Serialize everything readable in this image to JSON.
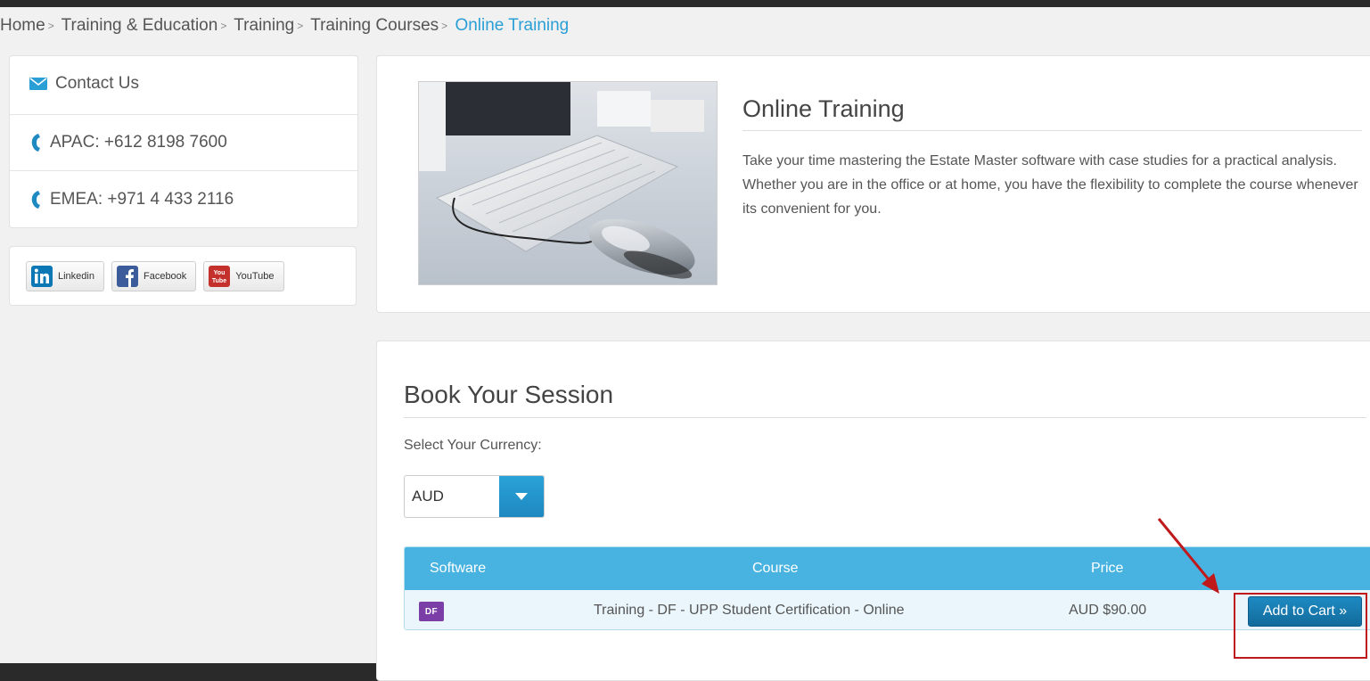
{
  "breadcrumb": {
    "items": [
      "Home",
      "Training & Education",
      "Training",
      "Training Courses"
    ],
    "current": "Online Training",
    "separator": ">"
  },
  "sidebar": {
    "contact": {
      "label": "Contact Us",
      "apac": "APAC: +612 8198 7600",
      "emea": "EMEA: +971 4 433 2116"
    },
    "social": {
      "linkedin": "Linkedin",
      "facebook": "Facebook",
      "youtube": "YouTube"
    }
  },
  "intro": {
    "title": "Online Training",
    "description": "Take your time mastering the Estate Master software with case studies for a practical analysis. Whether you are in the office or at home, you have the flexibility to complete the course whenever its convenient for you."
  },
  "booking": {
    "title": "Book Your Session",
    "currency_label": "Select Your Currency:",
    "currency_value": "AUD",
    "table": {
      "headers": [
        "Software",
        "Course",
        "Price"
      ],
      "rows": [
        {
          "software_badge": "DF",
          "course": "Training - DF - UPP Student Certification - Online",
          "price": "AUD $90.00",
          "action": "Add to Cart »"
        }
      ]
    }
  },
  "colors": {
    "accent": "#2a9fd6",
    "table_header": "#48b3e0",
    "button": "#1d8ac2",
    "highlight": "#c0191b",
    "df_badge": "#7a3ea6"
  },
  "icons": [
    "envelope-icon",
    "phone-icon",
    "linkedin-icon",
    "facebook-icon",
    "youtube-icon",
    "chevron-down-icon"
  ]
}
